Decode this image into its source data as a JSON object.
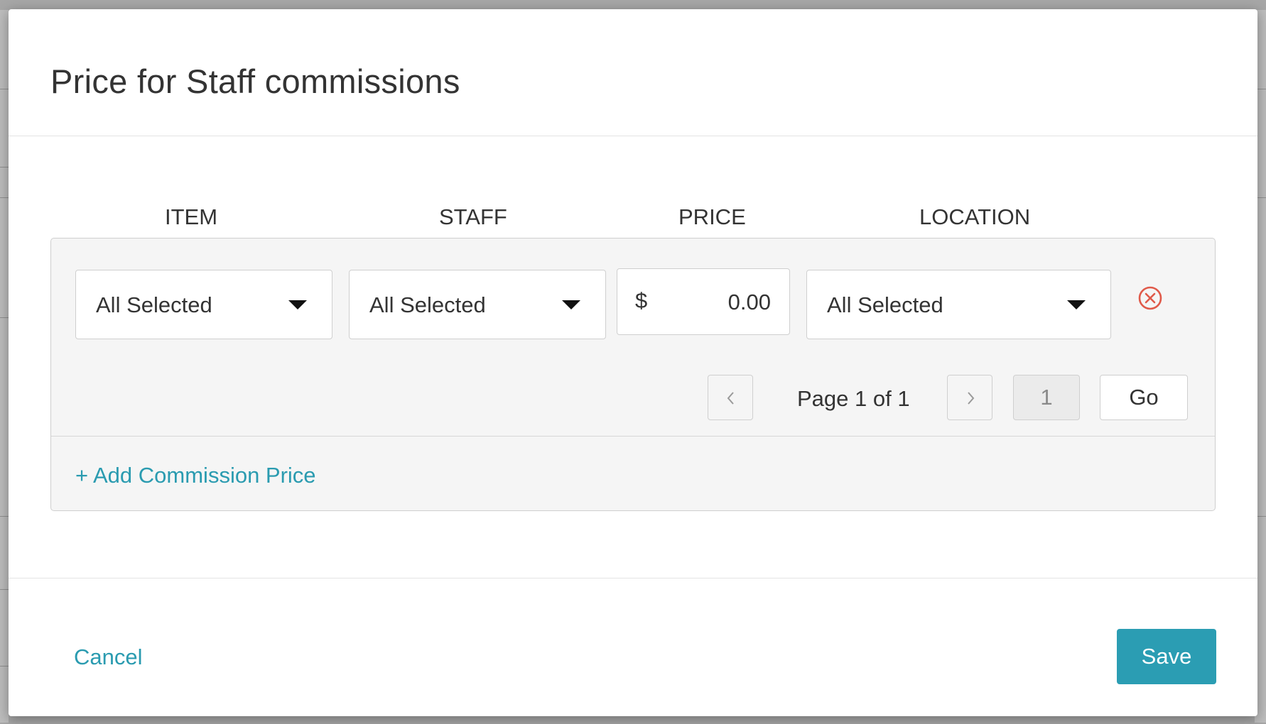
{
  "dialog": {
    "title": "Price for Staff commissions"
  },
  "columns": {
    "item": "ITEM",
    "staff": "STAFF",
    "price": "PRICE",
    "location": "LOCATION"
  },
  "row": {
    "item_select": "All Selected",
    "staff_select": "All Selected",
    "price_currency": "$",
    "price_amount": "0.00",
    "location_select": "All Selected",
    "remove_icon": "remove-circle-icon"
  },
  "pagination": {
    "label": "Page 1 of 1",
    "page_input": "1",
    "go_label": "Go",
    "prev_icon": "chevron-left-icon",
    "next_icon": "chevron-right-icon"
  },
  "panel": {
    "add_link": "+ Add Commission Price"
  },
  "footer": {
    "cancel_label": "Cancel",
    "save_label": "Save"
  },
  "colors": {
    "accent": "#2b9db3",
    "link": "#2a9bb0",
    "danger": "#e05a4a"
  }
}
